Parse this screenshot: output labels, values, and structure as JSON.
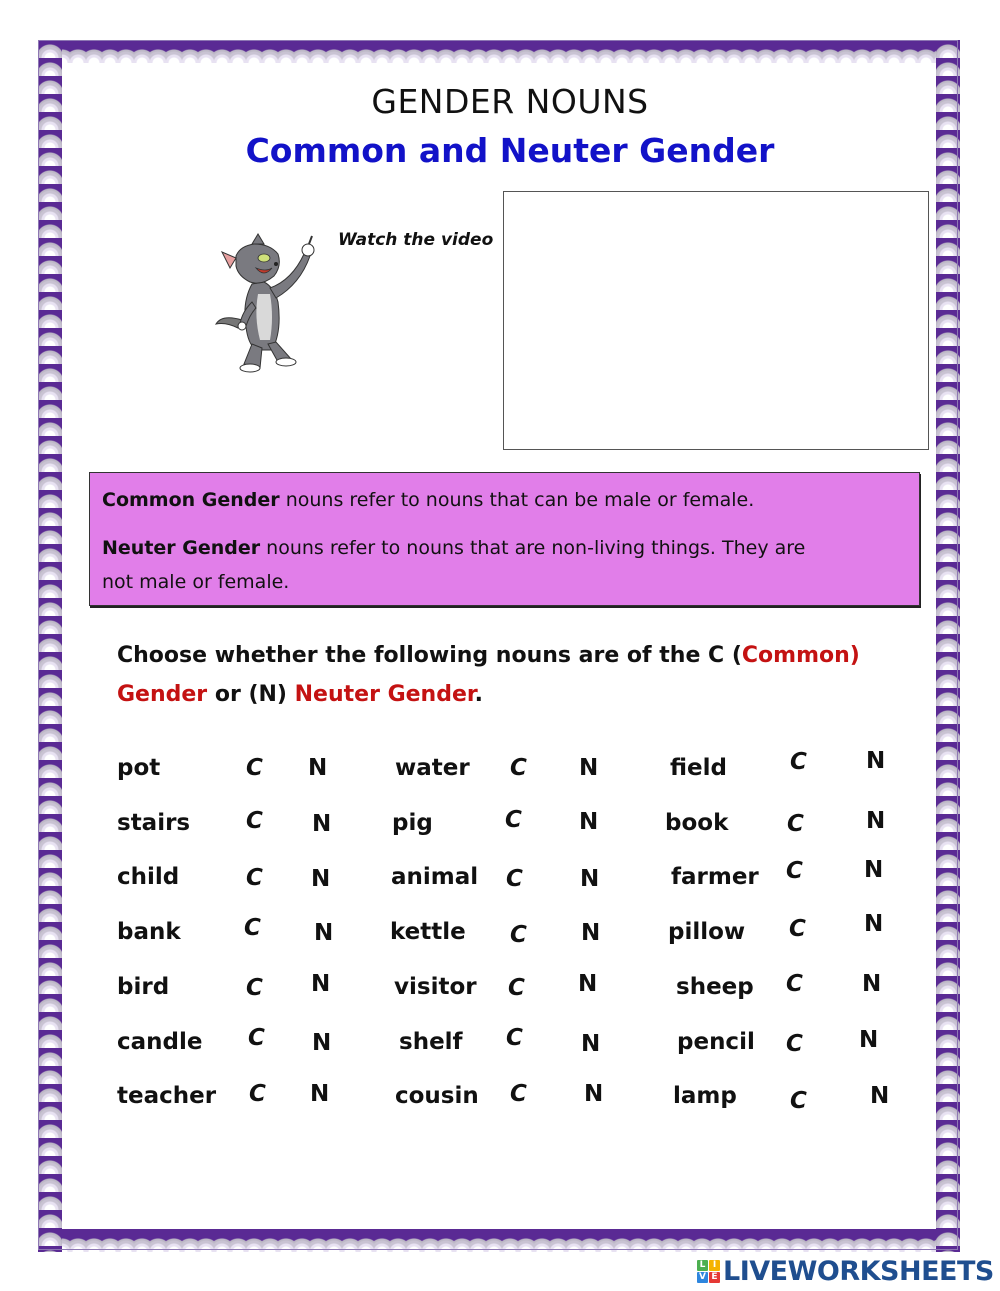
{
  "header": {
    "title": "GENDER NOUNS",
    "subtitle": "Common and Neuter Gender"
  },
  "video": {
    "prompt": "Watch the video",
    "illustration": "cartoon-cat"
  },
  "definitions": {
    "common_term": "Common Gender",
    "common_text": " nouns refer to nouns that can be male or female.",
    "neuter_term": "Neuter Gender",
    "neuter_text_line1": " nouns refer to nouns that are non-living things. They are",
    "neuter_text_line2": "not male or female."
  },
  "instructions": {
    "part1": "Choose whether the following nouns are of the C (",
    "common_word": "Common)",
    "gender_word": "Gender",
    "part2": " or (N) ",
    "neuter_phrase": "Neuter Gender",
    "end": "."
  },
  "options": {
    "c": "C",
    "n": "N"
  },
  "exercise": {
    "columns": [
      [
        "pot",
        "stairs",
        "child",
        "bank",
        "bird",
        "candle",
        "teacher"
      ],
      [
        "water",
        "pig",
        "animal",
        "kettle",
        "visitor",
        "shelf",
        "cousin"
      ],
      [
        "field",
        "book",
        "farmer",
        "pillow",
        "sheep",
        "pencil",
        "lamp"
      ]
    ]
  },
  "branding": {
    "logo_letters": [
      "L",
      "I",
      "V",
      "E"
    ],
    "logo_colors": [
      "#4caf50",
      "#f5b300",
      "#2e86de",
      "#e53935"
    ],
    "name": "LIVEWORKSHEETS",
    "name_color": "#1f4e8f"
  },
  "colors": {
    "border_purple": "#5a2a94",
    "subtitle_blue": "#1212c8",
    "info_box_pink": "#e17ee9",
    "highlight_red": "#c41212"
  }
}
